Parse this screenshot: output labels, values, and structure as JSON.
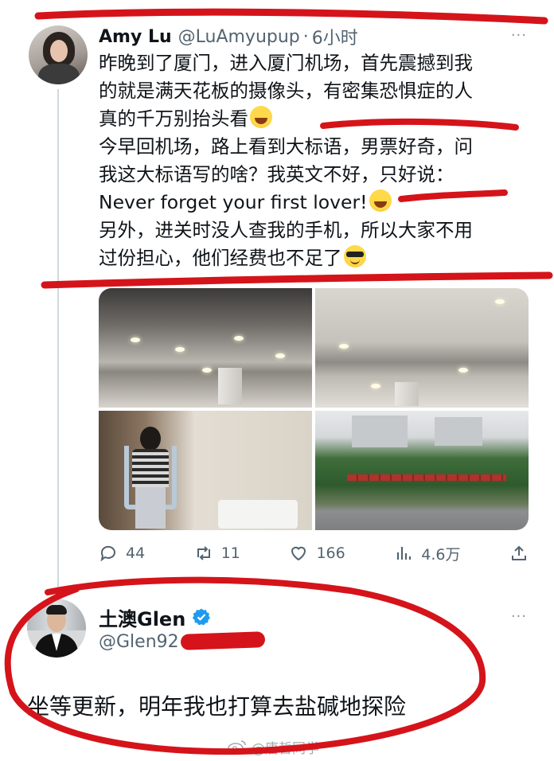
{
  "tweet1": {
    "author_name": "Amy Lu",
    "handle": "@LuAmyupup",
    "separator": "·",
    "time": "6小时",
    "more": "···",
    "lines": [
      "昨晚到了厦门，进入厦门机场，首先震撼到我",
      "的就是满天花板的摄像头，有密集恐惧症的人",
      "真的千万别抬头看",
      "今早回机场，路上看到大标语，男票好奇，问",
      "我这大标语写的啥？我英文不好，只好说：",
      "Never forget your first lover!",
      "另外，进关时没人查我的手机，所以大家不用",
      "过份担心，他们经费也不足了"
    ],
    "emoji": {
      "laugh": "face-with-tears-of-joy-icon",
      "cool": "smiling-face-with-sunglasses-icon"
    },
    "photos": [
      "airport-ceiling-cameras-photo",
      "airport-ceiling-cameras-photo",
      "mirror-selfie-photo",
      "roadside-slogan-fence-photo"
    ],
    "actions": {
      "replies": "44",
      "retweets": "11",
      "likes": "166",
      "views": "4.6万"
    }
  },
  "tweet2": {
    "author_name": "土澳Glen",
    "handle": "@Glen92",
    "more": "···",
    "text": "坐等更新，明年我也打算去盐碱地探险",
    "verified_color": "#1d9bf0"
  },
  "watermark": {
    "text": "@唐哲同学",
    "icon": "weibo-icon"
  },
  "colors": {
    "annotation_red": "#d4141a",
    "secondary_text": "#536471",
    "thread_line": "#cfd9de"
  }
}
